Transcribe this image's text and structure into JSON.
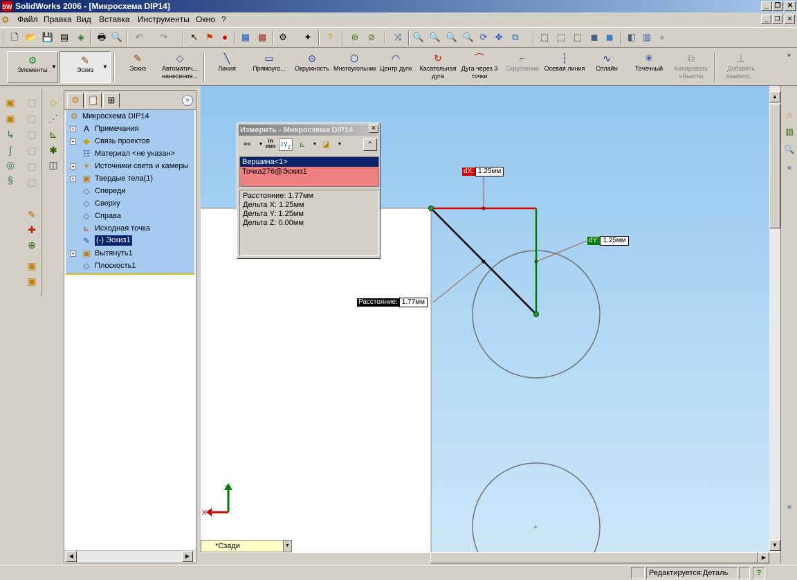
{
  "window": {
    "title": "SolidWorks 2006 - [Микросхема DIP14]",
    "app_icon": "solidworks-logo-icon",
    "controls": [
      "_",
      "❐",
      "✕"
    ],
    "mdi_controls": [
      "_",
      "❐",
      "✕"
    ]
  },
  "menu": {
    "items": [
      "Файл",
      "Правка",
      "Вид",
      "Вставка",
      "Инструменты",
      "Окно",
      "?"
    ]
  },
  "command_manager": {
    "elements_label": "Элементы",
    "sketch_label": "Эскиз",
    "tools": [
      {
        "label": "Эскиз",
        "icon": "sketch-icon",
        "enabled": true
      },
      {
        "label": "Автоматич... нанесение...",
        "icon": "smart-dimension-icon",
        "enabled": true
      },
      {
        "label": "Линия",
        "icon": "line-icon",
        "enabled": true
      },
      {
        "label": "Прямоуго...",
        "icon": "rectangle-icon",
        "enabled": true
      },
      {
        "label": "Окружность",
        "icon": "circle-icon",
        "enabled": true
      },
      {
        "label": "Многоугольник",
        "icon": "polygon-icon",
        "enabled": true
      },
      {
        "label": "Центр дуги",
        "icon": "center-arc-icon",
        "enabled": true
      },
      {
        "label": "Касательная дуга",
        "icon": "tangent-arc-icon",
        "enabled": true
      },
      {
        "label": "Дуга через 3 точки",
        "icon": "three-point-arc-icon",
        "enabled": true
      },
      {
        "label": "Скругление",
        "icon": "fillet-icon",
        "enabled": false
      },
      {
        "label": "Осевая линия",
        "icon": "centerline-icon",
        "enabled": true
      },
      {
        "label": "Сплайн",
        "icon": "spline-icon",
        "enabled": true
      },
      {
        "label": "Точечный",
        "icon": "point-icon",
        "enabled": true
      },
      {
        "label": "Копировать объекты",
        "icon": "copy-entities-icon",
        "enabled": false
      },
      {
        "label": "Добавить взаимос...",
        "icon": "add-relation-icon",
        "enabled": false
      }
    ]
  },
  "feature_manager": {
    "items": [
      {
        "label": "Микросхема DIP14",
        "icon": "part-icon",
        "expand": false,
        "indent": 0
      },
      {
        "label": "Примечания",
        "icon": "annotations-icon",
        "expand": true,
        "indent": 1
      },
      {
        "label": "Связь проектов",
        "icon": "design-binder-icon",
        "expand": true,
        "indent": 1
      },
      {
        "label": "Материал <не указан>",
        "icon": "material-icon",
        "expand": false,
        "indent": 1
      },
      {
        "label": "Источники света и камеры",
        "icon": "lights-icon",
        "expand": true,
        "indent": 1
      },
      {
        "label": "Твердые тела(1)",
        "icon": "solid-bodies-icon",
        "expand": true,
        "indent": 1
      },
      {
        "label": "Спереди",
        "icon": "plane-icon",
        "expand": false,
        "indent": 1
      },
      {
        "label": "Сверху",
        "icon": "plane-icon",
        "expand": false,
        "indent": 1
      },
      {
        "label": "Справа",
        "icon": "plane-icon",
        "expand": false,
        "indent": 1
      },
      {
        "label": "Исходная точка",
        "icon": "origin-icon",
        "expand": false,
        "indent": 1
      },
      {
        "label": "(-) Эскиз1",
        "icon": "sketch-icon",
        "expand": false,
        "indent": 1,
        "selected": true
      },
      {
        "label": "Вытянуть1",
        "icon": "extrude-icon",
        "expand": true,
        "indent": 1
      },
      {
        "label": "Плоскость1",
        "icon": "plane-icon",
        "expand": false,
        "indent": 1
      }
    ]
  },
  "measure": {
    "title": "Измерить - Микросхема DIP14",
    "close": "✕",
    "units_icon_text": "in mm",
    "selections": [
      "Вершина<1>",
      "Точка276@Эскиз1"
    ],
    "results": [
      "Расстояние: 1.77мм",
      "Дельта X: 1.25мм",
      "Дельта Y: 1.25мм",
      "Дельта Z: 0.00мм"
    ]
  },
  "callouts": {
    "dx": {
      "key": "dX:",
      "value": "1.25мм"
    },
    "dy": {
      "key": "dY:",
      "value": "1.25мм"
    },
    "distance": {
      "key": "Расстояние:",
      "value": "1.77мм"
    }
  },
  "triad": {
    "x": "X",
    "y": "Y"
  },
  "view": {
    "name": "*Сзади"
  },
  "status": {
    "mode": "Редактируется:Деталь",
    "help": "?"
  },
  "colors": {
    "viewport_top": "#93c5ee",
    "selection_pink": "#f07f7f",
    "dx_red": "#dd0000",
    "dy_green": "#008000"
  }
}
